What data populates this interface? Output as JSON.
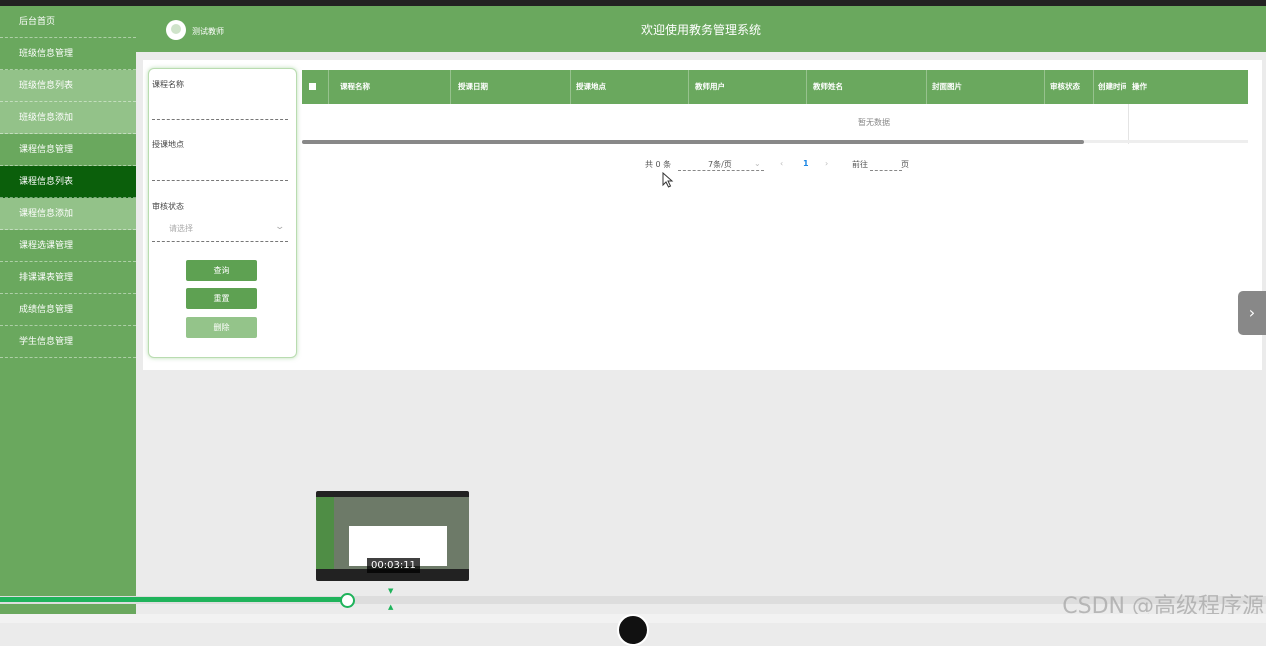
{
  "sidebar": {
    "items": [
      {
        "label": "后台首页"
      },
      {
        "label": "班级信息管理"
      },
      {
        "label": "班级信息列表"
      },
      {
        "label": "班级信息添加"
      },
      {
        "label": "课程信息管理"
      },
      {
        "label": "课程信息列表"
      },
      {
        "label": "课程信息添加"
      },
      {
        "label": "课程选课管理"
      },
      {
        "label": "排课课表管理"
      },
      {
        "label": "成绩信息管理"
      },
      {
        "label": "学生信息管理"
      }
    ]
  },
  "header": {
    "username": "测试教师",
    "title": "欢迎使用教务管理系统"
  },
  "filter": {
    "course_name_label": "课程名称",
    "location_label": "授课地点",
    "status_label": "审核状态",
    "status_placeholder": "请选择",
    "query_button": "查询",
    "reset_button": "重置",
    "delete_button": "删除"
  },
  "table": {
    "columns": [
      "课程名称",
      "授课日期",
      "授课地点",
      "教师用户",
      "教师姓名",
      "封面图片",
      "审核状态",
      "创建时间",
      "操作"
    ],
    "empty_text": "暂无数据"
  },
  "pagination": {
    "total": "共 0 条",
    "page_size": "7条/页",
    "current_page": "1",
    "goto_label": "前往",
    "page_unit": "页"
  },
  "video": {
    "timestamp": "00:03:11",
    "progress": 0.274
  },
  "watermark": "CSDN @高级程序源",
  "colors": {
    "primary": "#6aa85e",
    "sidebar_active": "#0b5f0b",
    "sidebar_sub": "#93c289",
    "progress": "#1fb35b"
  }
}
